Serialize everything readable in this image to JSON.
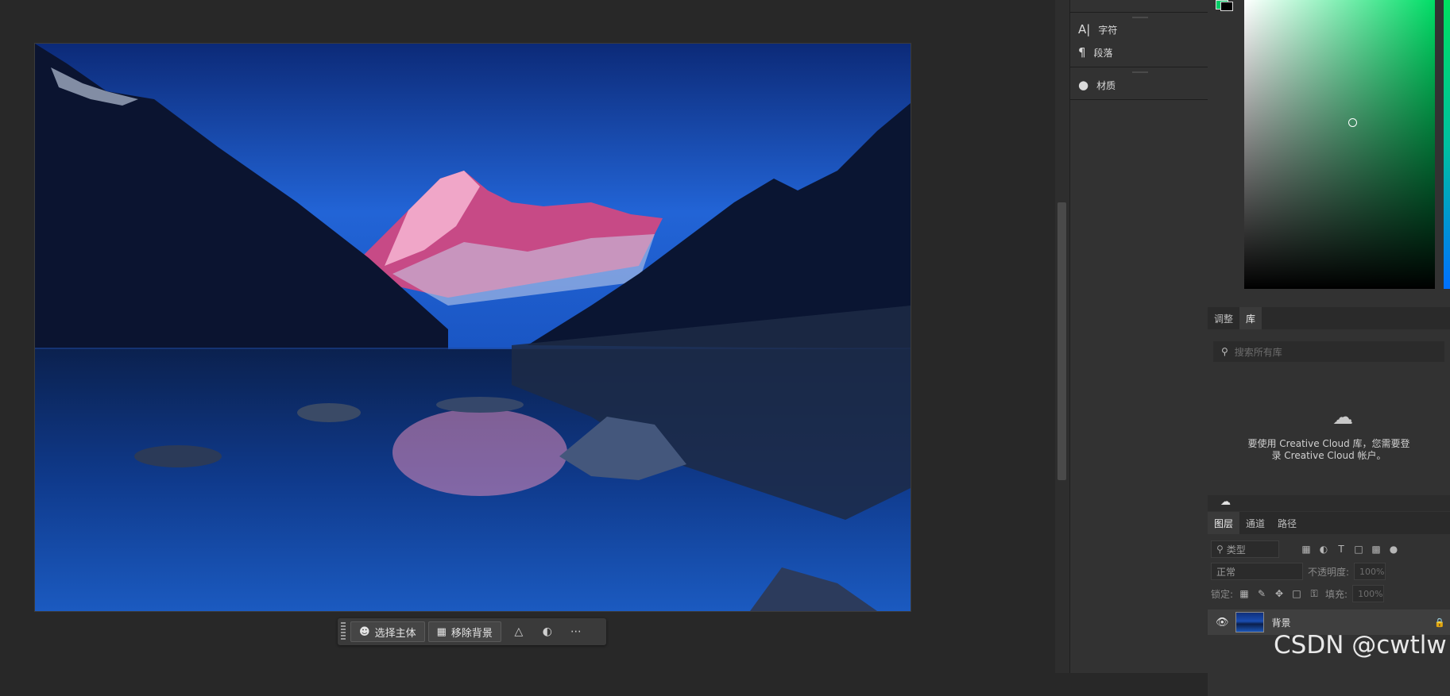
{
  "taskbar": {
    "select_subject": "选择主体",
    "remove_background": "移除背景"
  },
  "dock": {
    "character": "字符",
    "paragraph": "段落",
    "material": "材质"
  },
  "adjust_tabs": [
    "调整",
    "库"
  ],
  "library": {
    "search_placeholder": "搜索所有库",
    "message_line1": "要使用 Creative Cloud 库，您需要登",
    "message_line2": "录 Creative Cloud 帐户。"
  },
  "layer_tabs": [
    "图层",
    "通道",
    "路径"
  ],
  "layers": {
    "filter_kind": "类型",
    "blend_mode": "正常",
    "opacity_label": "不透明度:",
    "opacity_value": "100%",
    "lock_label": "锁定:",
    "fill_label": "填充:",
    "fill_value": "100%",
    "layer_name": "背景"
  },
  "colors": {
    "foreground": "#00cc66",
    "background": "#000000",
    "panel": "#323232"
  },
  "watermark": "CSDN @cwtlw"
}
